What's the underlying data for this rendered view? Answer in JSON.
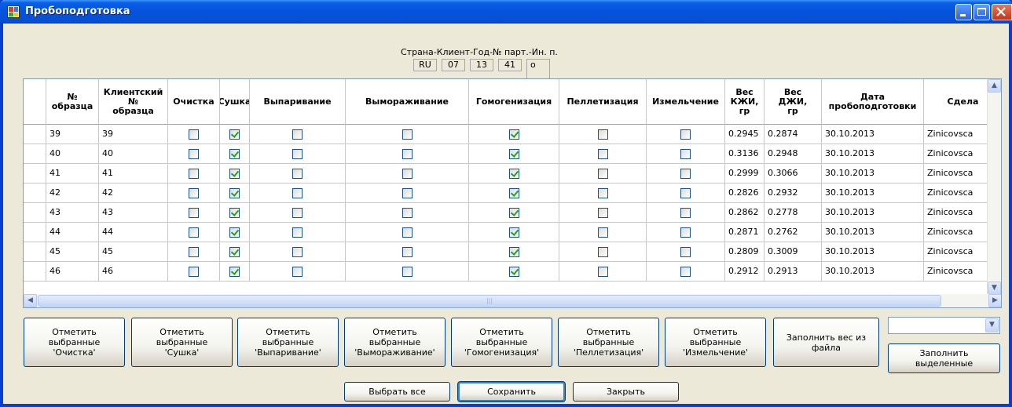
{
  "window": {
    "title": "Пробоподготовка"
  },
  "header": {
    "caption": "Страна-Клиент-Год-№ парт.-Ин. п.",
    "codes": [
      "RU",
      "07",
      "13",
      "41",
      "o"
    ]
  },
  "grid": {
    "columns": [
      "№\nобразца",
      "Клиентский\n№\nобразца",
      "Очистка",
      "Сушка",
      "Выпаривание",
      "Вымораживание",
      "Гомогенизация",
      "Пеллетизация",
      "Измельчение",
      "Вес\nКЖИ,\nгр",
      "Вес\nДЖИ,\nгр",
      "Дата\nпробоподготовки",
      "Сдела"
    ],
    "rows": [
      {
        "num": "39",
        "client": "39",
        "checks": [
          false,
          true,
          false,
          false,
          true,
          false,
          false
        ],
        "kji": "0.2945",
        "dji": "0.2874",
        "date": "30.10.2013",
        "by": "Zinicovsca"
      },
      {
        "num": "40",
        "client": "40",
        "checks": [
          false,
          true,
          false,
          false,
          true,
          false,
          false
        ],
        "kji": "0.3136",
        "dji": "0.2948",
        "date": "30.10.2013",
        "by": "Zinicovsca"
      },
      {
        "num": "41",
        "client": "41",
        "checks": [
          false,
          true,
          false,
          false,
          true,
          false,
          false
        ],
        "kji": "0.2999",
        "dji": "0.3066",
        "date": "30.10.2013",
        "by": "Zinicovsca"
      },
      {
        "num": "42",
        "client": "42",
        "checks": [
          false,
          true,
          false,
          false,
          true,
          false,
          false
        ],
        "kji": "0.2826",
        "dji": "0.2932",
        "date": "30.10.2013",
        "by": "Zinicovsca"
      },
      {
        "num": "43",
        "client": "43",
        "checks": [
          false,
          true,
          false,
          false,
          true,
          false,
          false
        ],
        "kji": "0.2862",
        "dji": "0.2778",
        "date": "30.10.2013",
        "by": "Zinicovsca"
      },
      {
        "num": "44",
        "client": "44",
        "checks": [
          false,
          true,
          false,
          false,
          true,
          false,
          false
        ],
        "kji": "0.2871",
        "dji": "0.2762",
        "date": "30.10.2013",
        "by": "Zinicovsca"
      },
      {
        "num": "45",
        "client": "45",
        "checks": [
          false,
          true,
          false,
          false,
          true,
          false,
          false
        ],
        "kji": "0.2809",
        "dji": "0.3009",
        "date": "30.10.2013",
        "by": "Zinicovsca"
      },
      {
        "num": "46",
        "client": "46",
        "checks": [
          false,
          true,
          false,
          false,
          true,
          false,
          false
        ],
        "kji": "0.2912",
        "dji": "0.2913",
        "date": "30.10.2013",
        "by": "Zinicovsca"
      }
    ]
  },
  "buttons": {
    "mark_cleaning": "Отметить\nвыбранные\n'Очистка'",
    "mark_drying": "Отметить\nвыбранные\n'Сушка'",
    "mark_evaporation": "Отметить\nвыбранные\n'Выпаривание'",
    "mark_freezing": "Отметить\nвыбранные\n'Вымораживание'",
    "mark_homogenization": "Отметить\nвыбранные\n'Гомогенизация'",
    "mark_pelletizing": "Отметить\nвыбранные\n'Пеллетизация'",
    "mark_grinding": "Отметить\nвыбранные\n'Измельчение'",
    "fill_weight_file": "Заполнить вес из\nфайла",
    "fill_selected": "Заполнить\nвыделенные",
    "select_all": "Выбрать все",
    "save": "Сохранить",
    "close": "Закрыть"
  },
  "combo": {
    "value": ""
  },
  "icons": {
    "row_scroll_up": "chevron-up-icon",
    "row_scroll_down": "chevron-down-icon",
    "scroll_left": "chevron-left-icon",
    "scroll_right": "chevron-right-icon"
  }
}
